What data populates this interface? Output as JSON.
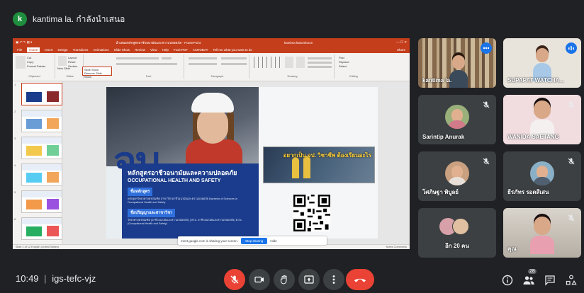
{
  "presenter": {
    "initial": "k",
    "text": "kantima la. กำลังนำเสนอ"
  },
  "ppt": {
    "window_title": "นำเสนอหลักสูตรอาชีวอนามัยและความปลอดภัย - PowerPoint",
    "account": "kantima latsomboon",
    "tabs": [
      "File",
      "Home",
      "Insert",
      "Design",
      "Transitions",
      "Animations",
      "Slide Show",
      "Review",
      "View",
      "Help",
      "Foxit PDF",
      "ACROBAT",
      "Tell me what you want to do"
    ],
    "share_label": "Share",
    "ribbon_groups": [
      "Clipboard",
      "Slides",
      "Font",
      "Paragraph",
      "Drawing",
      "Editing"
    ],
    "clipboard_cut": "Cut",
    "clipboard_copy": "Copy",
    "clipboard_format": "Format Painter",
    "slides_new": "New Slide",
    "slides_layout": "Layout",
    "slides_reset": "Reset",
    "slides_section": "Section",
    "editing_find": "Find",
    "editing_replace": "Replace",
    "editing_select": "Select",
    "popup_line1": "Slide Show",
    "popup_line2": "Resume Slide Show",
    "status_left": "Slide 1 of 12   English (United States)",
    "status_right": "Notes   Comments"
  },
  "slide": {
    "big_text": "จบ",
    "program_th": "หลักสูตรอาชีวอนามัยและความปลอดภัย",
    "program_en": "OCCUPATIONAL HEALTH AND SAFETY",
    "chip1": "ชื่อหลักสูตร",
    "chip1_small": "หลักสูตรวิทยาศาสตรบัณฑิต สาขาวิชาอาชีวอนามัยและความปลอดภัย Bachelor of Sciences in Occupational Health and Safety",
    "chip2": "ชื่อปริญญาและสาขาวิชา",
    "chip2_small": "วิทยาศาสตรบัณฑิต (อาชีวอนามัยและความปลอดภัย) (วท.บ. อาชีวอนามัยและความปลอดภัย) B.Sc. (Occupational Health and Safety)",
    "photo_text": "อยากเป็น จป. วิชาชีพ ต้องเรียนอะไร"
  },
  "sharing": {
    "text": "meet.google.com is sharing your screen.",
    "stop": "Stop sharing",
    "hide": "Hide"
  },
  "participants": [
    {
      "name": "kantima la.",
      "mic": "speaking"
    },
    {
      "name": "SUPAPAT WATCHA...",
      "mic": "speaking"
    },
    {
      "name": "Sarintip Anurak",
      "mic": "muted"
    },
    {
      "name": "WANIDA SAETANG",
      "mic": "muted"
    },
    {
      "name": "โศภิษฐา พิบูลย์",
      "mic": "muted"
    },
    {
      "name": "ธีรภัทร รอดสีเสน",
      "mic": "muted"
    },
    {
      "name": "อีก 20 คน",
      "mic": "muted"
    },
    {
      "name": "คุณ",
      "mic": "muted"
    }
  ],
  "bottom": {
    "time": "10:49",
    "separator": "|",
    "meeting_code": "igs-tefc-vjz",
    "people_count": "28"
  },
  "colors": {
    "meet_bg": "#202124",
    "tile_bg": "#3c4043",
    "danger": "#ea4335",
    "ppt_accent": "#c43e1c",
    "slide_blue": "#1b3c8c"
  }
}
